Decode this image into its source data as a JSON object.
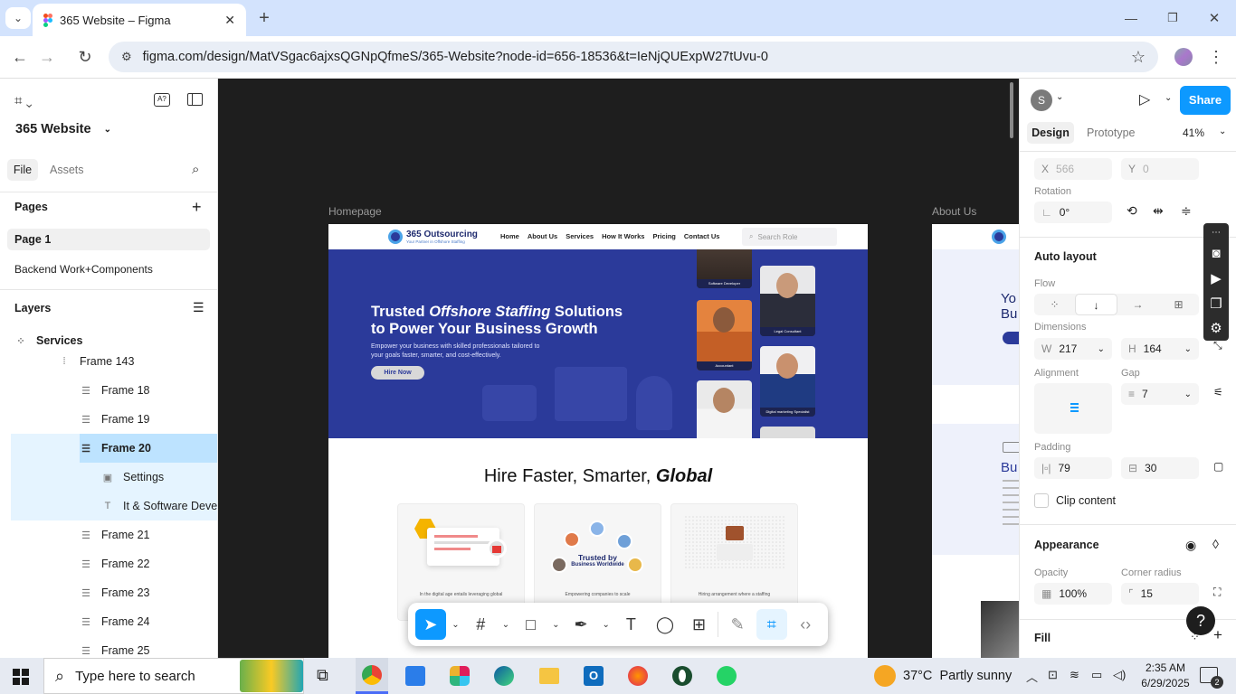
{
  "browser": {
    "tab_title": "365 Website – Figma",
    "url": "figma.com/design/MatVSgac6ajxsQGNpQfmeS/365-Website?node-id=656-18536&t=IeNjQUExpW27tUvu-0"
  },
  "left_panel": {
    "file_name": "365 Website",
    "tabs": [
      "File",
      "Assets"
    ],
    "pages_title": "Pages",
    "pages": [
      "Page 1",
      "Backend Work+Components"
    ],
    "layers_title": "Layers",
    "layers": [
      {
        "label": "Services",
        "icon": "component-icon"
      },
      {
        "label": "Frame 143",
        "icon": "frame-icon"
      },
      {
        "label": "Frame 18",
        "icon": "autolayout-icon"
      },
      {
        "label": "Frame 19",
        "icon": "autolayout-icon"
      },
      {
        "label": "Frame 20",
        "icon": "autolayout-icon"
      },
      {
        "label": "Settings",
        "icon": "image-icon"
      },
      {
        "label": "It & Software Develo",
        "icon": "text-icon"
      },
      {
        "label": "Frame 21",
        "icon": "autolayout-icon"
      },
      {
        "label": "Frame 22",
        "icon": "autolayout-icon"
      },
      {
        "label": "Frame 23",
        "icon": "autolayout-icon"
      },
      {
        "label": "Frame 24",
        "icon": "autolayout-icon"
      },
      {
        "label": "Frame 25",
        "icon": "autolayout-icon"
      }
    ]
  },
  "canvas": {
    "frame1_label": "Homepage",
    "frame2_label": "About Us",
    "site": {
      "logo": "365 Outsourcing",
      "tagline": "Your Partner in Offshore Staffing",
      "nav": [
        "Home",
        "About Us",
        "Services",
        "How It Works",
        "Pricing",
        "Contact Us"
      ],
      "search_placeholder": "Search Role",
      "hero_title_1": "Trusted ",
      "hero_title_italic": "Offshore Staffing",
      "hero_title_2": " Solutions",
      "hero_title_3": "to Power Your Business Growth",
      "hero_sub": "Empower your business with skilled professionals tailored to your goals faster, smarter, and cost-effectively.",
      "hero_button": "Hire Now",
      "roles": [
        "Software Developer",
        "Legal Consultant",
        "Accountant",
        "Digital marketing Specialist"
      ],
      "section_title_1": "Hire Faster, Smarter, ",
      "section_title_italic": "Global",
      "card_center_title": "Trusted by",
      "card_center_sub": "Business Worldwide",
      "cards": [
        "In the digital age entails leveraging global",
        "Empowering companies to scale",
        "Hiring arrangement where a staffing"
      ]
    },
    "about": {
      "line1": "Yo",
      "line2": "Bu",
      "line3": "Bu"
    }
  },
  "right_panel": {
    "avatar": "S",
    "share": "Share",
    "tabs": [
      "Design",
      "Prototype"
    ],
    "zoom": "41%",
    "x": "566",
    "y": "0",
    "rotation_label": "Rotation",
    "rotation": "0°",
    "auto_layout": "Auto layout",
    "flow_label": "Flow",
    "dimensions_label": "Dimensions",
    "w": "217",
    "h": "164",
    "alignment_label": "Alignment",
    "gap_label": "Gap",
    "gap": "7",
    "padding_label": "Padding",
    "pad_h": "79",
    "pad_v": "30",
    "clip": "Clip content",
    "appearance": "Appearance",
    "opacity_label": "Opacity",
    "opacity": "100%",
    "radius_label": "Corner radius",
    "radius": "15",
    "fill": "Fill"
  },
  "taskbar": {
    "search": "Type here to search",
    "weather": "37°C  Partly sunny",
    "time": "2:35 AM",
    "date": "6/29/2025",
    "notif": "2"
  },
  "colors": {
    "figma_blue": "#0d99ff",
    "site_blue": "#2b3a9a",
    "chrome_tab": "#d3e3fd"
  }
}
